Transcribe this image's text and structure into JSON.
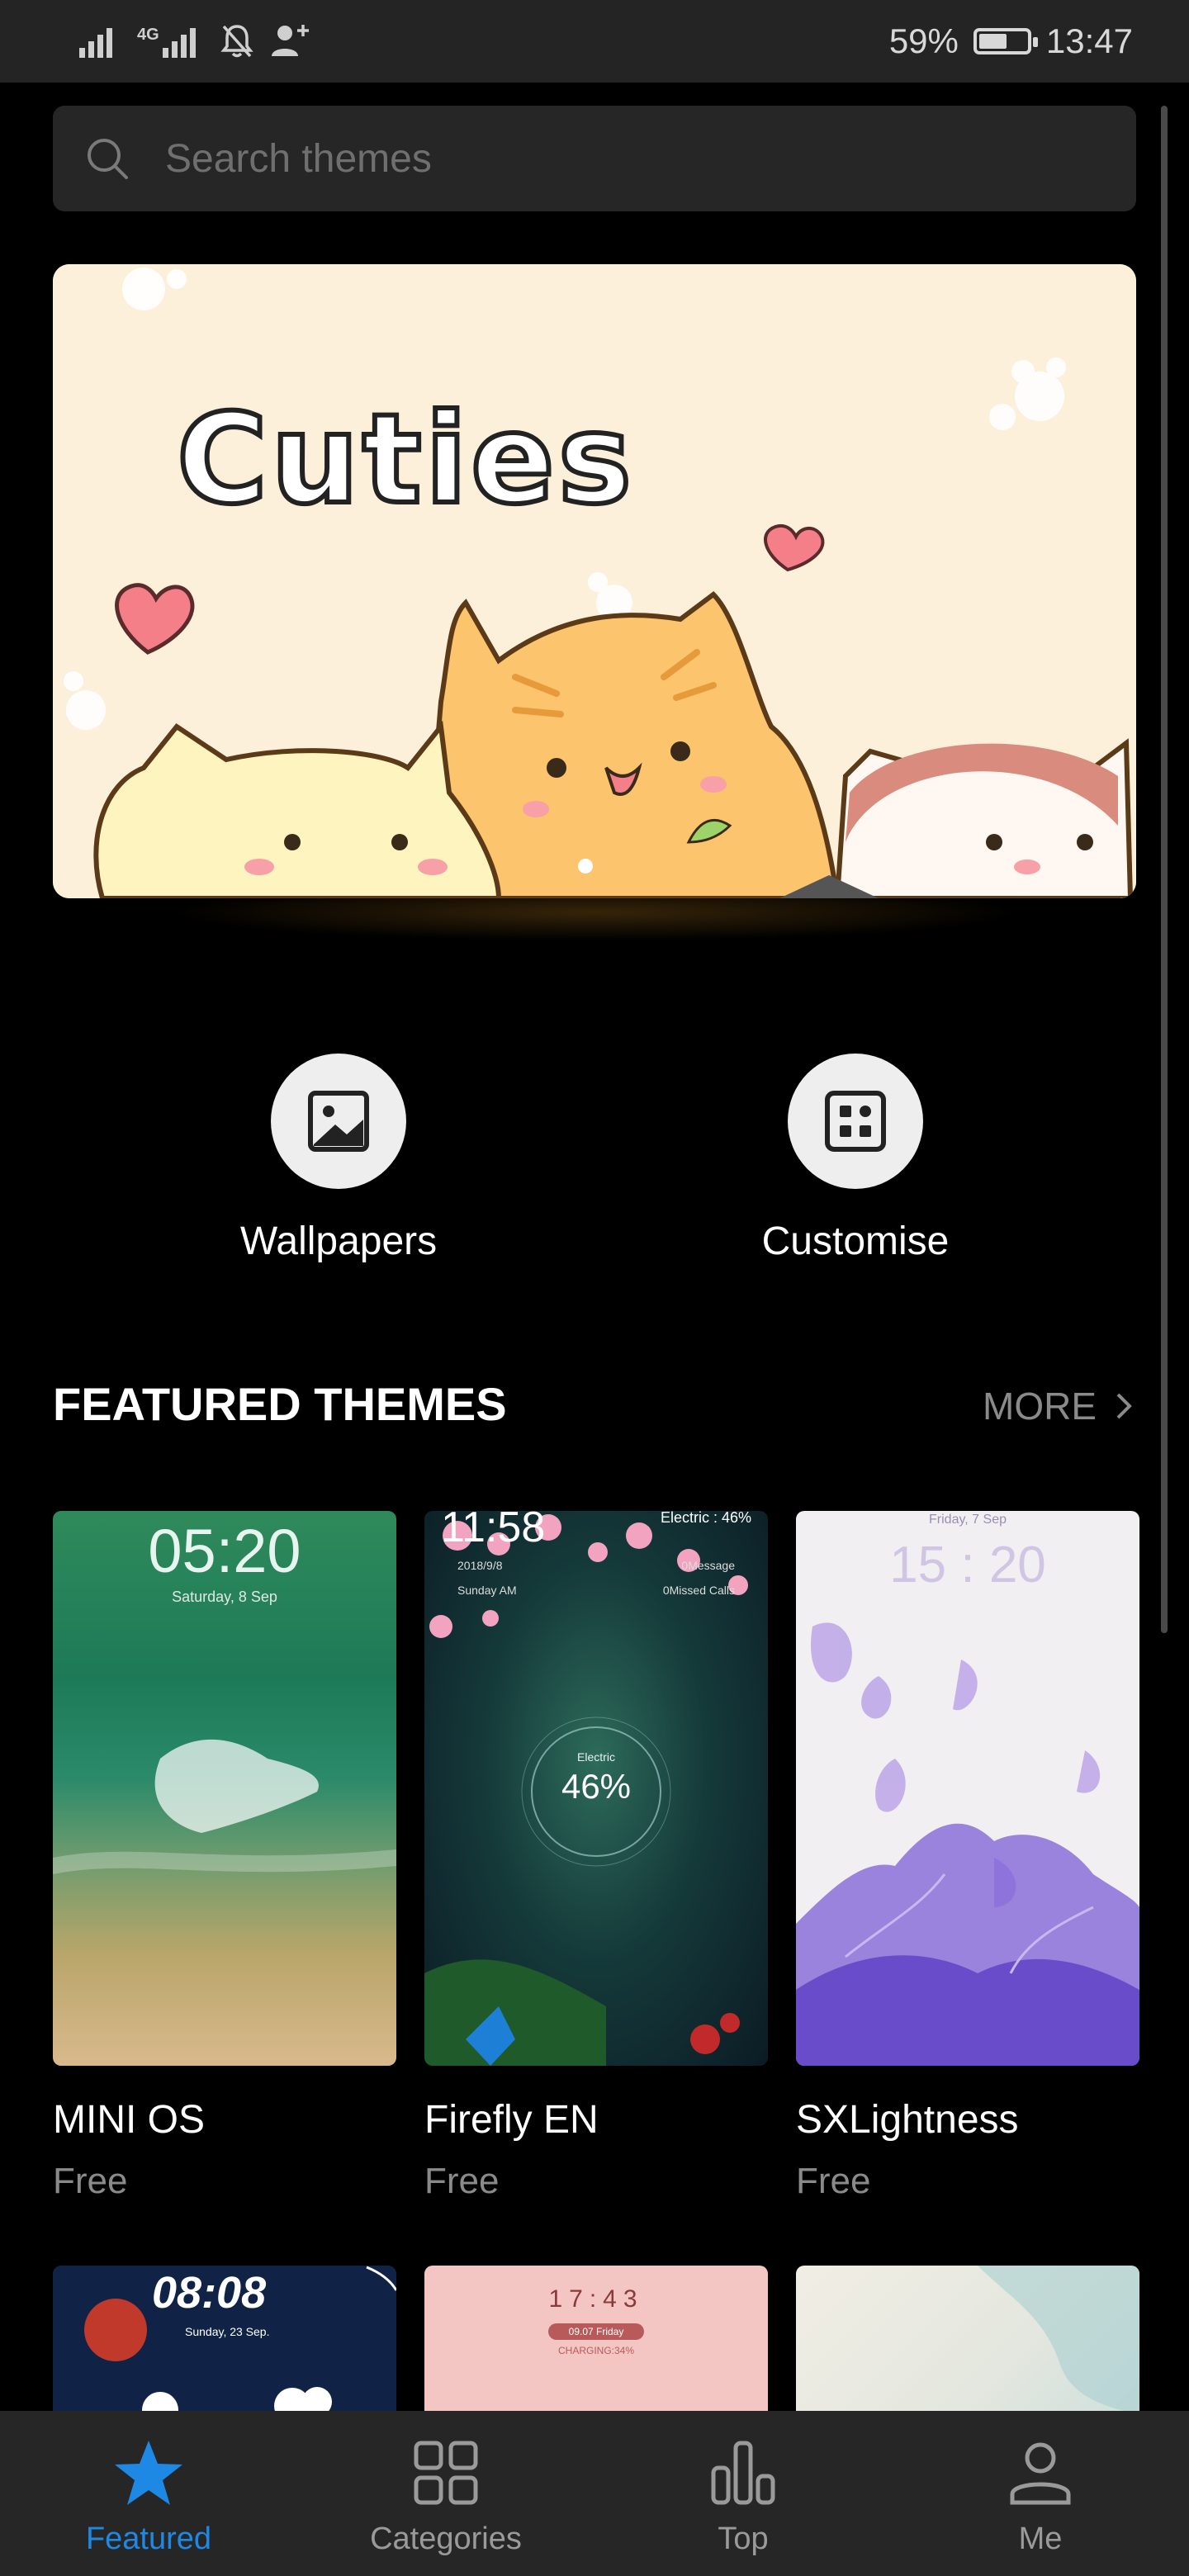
{
  "status_bar": {
    "signal_label": "4G",
    "battery": "59%",
    "battery_level": 0.59,
    "time": "13:47"
  },
  "search": {
    "placeholder": "Search themes",
    "value": ""
  },
  "banner": {
    "title": "Cuties",
    "page_indicator": "1"
  },
  "quick_actions": [
    {
      "label": "Wallpapers",
      "icon": "image-icon"
    },
    {
      "label": "Customise",
      "icon": "customise-icon"
    }
  ],
  "featured": {
    "title": "FEATURED THEMES",
    "more_label": "MORE",
    "themes": [
      {
        "name": "MINI OS",
        "price": "Free",
        "preview_time": "05:20",
        "preview_date": "Saturday, 8 Sep"
      },
      {
        "name": "Firefly EN",
        "price": "Free",
        "preview_time": "11:58",
        "preview_date": "2018/9/8",
        "preview_day": "Sunday AM",
        "preview_electric_label": "Electric",
        "preview_electric": "46%",
        "preview_status": "Electric : 46%",
        "preview_message": "0Message",
        "preview_calls": "0Missed Calls"
      },
      {
        "name": "SXLightness",
        "price": "Free",
        "preview_time": "15 : 20",
        "preview_date": "Friday, 7 Sep"
      }
    ],
    "next_row": [
      {
        "preview_time": "08:08",
        "preview_date": "Sunday, 23 Sep."
      },
      {
        "preview_time": "17:43",
        "preview_date": "09.07 Friday",
        "preview_status": "CHARGING:34%"
      },
      {}
    ]
  },
  "tab_bar": {
    "active_color": "#1e88e5",
    "tabs": [
      {
        "label": "Featured",
        "icon": "star-icon",
        "active": true
      },
      {
        "label": "Categories",
        "icon": "grid-icon",
        "active": false
      },
      {
        "label": "Top",
        "icon": "bar-chart-icon",
        "active": false
      },
      {
        "label": "Me",
        "icon": "person-icon",
        "active": false
      }
    ]
  }
}
